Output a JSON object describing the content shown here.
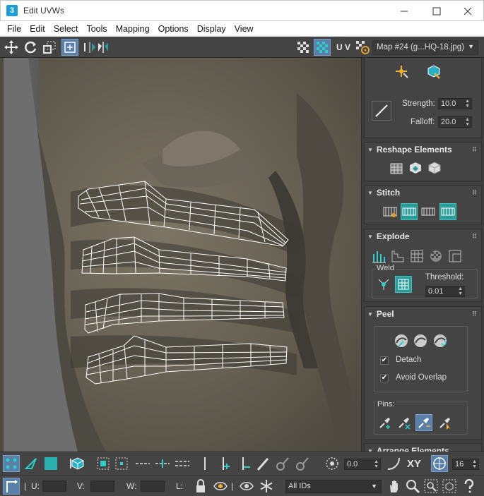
{
  "window": {
    "title": "Edit UVWs",
    "app_glyph": "3"
  },
  "menu": [
    "File",
    "Edit",
    "Select",
    "Tools",
    "Mapping",
    "Options",
    "Display",
    "View"
  ],
  "toolbar": {
    "uv_label": "U V",
    "map_label": "Map #24 (g...HQ-18.jpg)"
  },
  "panel": {
    "brush": {
      "strength_label": "Strength:",
      "strength_value": "10.0",
      "falloff_label": "Falloff:",
      "falloff_value": "20.0"
    },
    "reshape": {
      "title": "Reshape Elements"
    },
    "stitch": {
      "title": "Stitch"
    },
    "explode": {
      "title": "Explode",
      "weld_label": "Weld",
      "threshold_label": "Threshold:",
      "threshold_value": "0.01"
    },
    "peel": {
      "title": "Peel",
      "detach_label": "Detach",
      "avoid_overlap_label": "Avoid Overlap",
      "pins_label": "Pins:"
    },
    "arrange": {
      "title": "Arrange Elements"
    }
  },
  "bottom": {
    "rotation_value": "0.0",
    "xy_label": "XY",
    "grid_value": "16",
    "u_label": "U:",
    "v_label": "V:",
    "w_label": "W:",
    "l_label": "L:",
    "ids_label": "All IDs"
  },
  "colors": {
    "accent_teal": "#2a9c9a",
    "active_blue": "#5a7fa8"
  }
}
